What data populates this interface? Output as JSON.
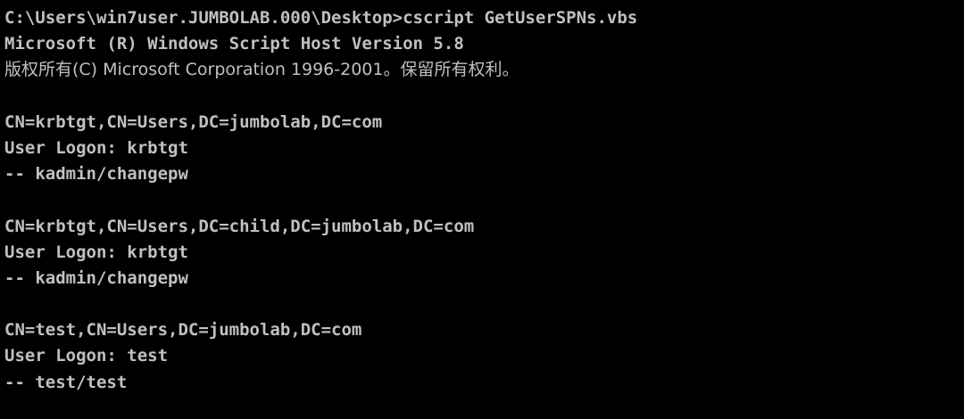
{
  "console": {
    "colors": {
      "background": "#000000",
      "foreground": "#c0c0c0"
    },
    "lines": [
      "C:\\Users\\win7user.JUMBOLAB.000\\Desktop>cscript GetUserSPNs.vbs",
      "Microsoft (R) Windows Script Host Version 5.8",
      "版权所有(C) Microsoft Corporation 1996-2001。保留所有权利。",
      "",
      "CN=krbtgt,CN=Users,DC=jumbolab,DC=com",
      "User Logon: krbtgt",
      "-- kadmin/changepw",
      "",
      "CN=krbtgt,CN=Users,DC=child,DC=jumbolab,DC=com",
      "User Logon: krbtgt",
      "-- kadmin/changepw",
      "",
      "CN=test,CN=Users,DC=jumbolab,DC=com",
      "User Logon: test",
      "-- test/test"
    ]
  }
}
